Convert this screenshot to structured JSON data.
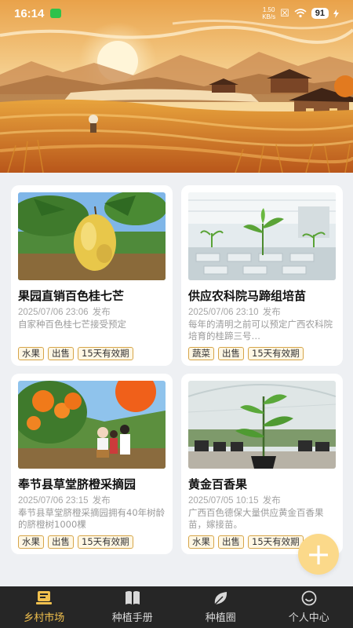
{
  "status_bar": {
    "time": "16:14",
    "network_speed_value": "1.50",
    "network_speed_unit": "KB/s",
    "battery": "91"
  },
  "cards": [
    {
      "title": "果园直销百色桂七芒",
      "date": "2025/07/06 23:06",
      "date_suffix": "发布",
      "description": "自家种百色桂七芒接受预定",
      "tags": [
        "水果",
        "出售",
        "15天有效期"
      ]
    },
    {
      "title": "供应农科院马蹄组培苗",
      "date": "2025/07/06 23:10",
      "date_suffix": "发布",
      "description": "每年的清明之前可以预定广西农科院培育的桂蹄三号…",
      "tags": [
        "蔬菜",
        "出售",
        "15天有效期"
      ]
    },
    {
      "title": "奉节县草堂脐橙采摘园",
      "date": "2025/07/06 23:15",
      "date_suffix": "发布",
      "description": "奉节县草堂脐橙采摘园拥有40年树龄的脐橙树1000棵",
      "tags": [
        "水果",
        "出售",
        "15天有效期"
      ]
    },
    {
      "title": "黄金百香果",
      "date": "2025/07/05 10:15",
      "date_suffix": "发布",
      "description": "广西百色德保大量供应黄金百香果苗，嫁接苗。",
      "tags": [
        "水果",
        "出售",
        "15天有效期"
      ]
    }
  ],
  "fab": {
    "label": "+"
  },
  "tabbar": {
    "items": [
      {
        "label": "乡村市场",
        "icon": "market-icon",
        "active": true
      },
      {
        "label": "种植手册",
        "icon": "book-icon",
        "active": false
      },
      {
        "label": "种植圈",
        "icon": "leaf-icon",
        "active": false
      },
      {
        "label": "个人中心",
        "icon": "profile-icon",
        "active": false
      }
    ]
  },
  "colors": {
    "accent": "#f2c14e",
    "tag_border": "#d6a548",
    "tabbar_bg": "#262626"
  }
}
